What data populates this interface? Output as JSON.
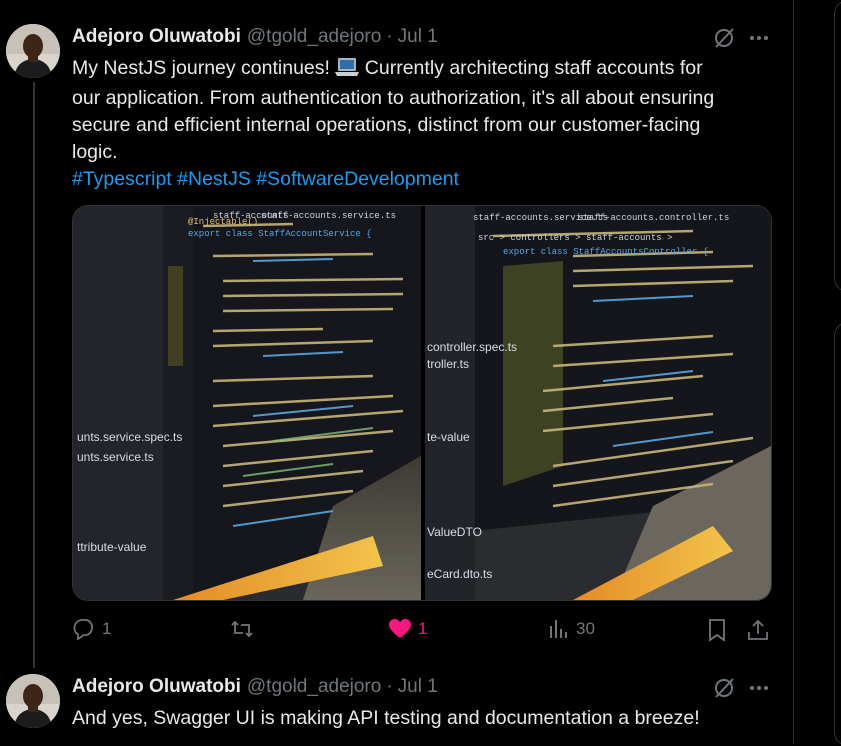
{
  "tweet1": {
    "author_name": "Adejoro Oluwatobi",
    "handle": "@tgold_adejoro",
    "separator": "·",
    "date": "Jul 1",
    "text_line1": "My NestJS journey continues! ",
    "emoji": "laptop-emoji",
    "text_line1b": " Currently architecting staff accounts for",
    "text_line2": "our application. From authentication to authorization, it's all about ensuring",
    "text_line3": "secure and efficient internal operations, distinct from our customer-facing",
    "text_line4": "logic.",
    "hashtags": [
      "#Typescript",
      "#NestJS",
      "#SoftwareDevelopment"
    ],
    "media": {
      "left_photo_icon": "code-editor-photo",
      "right_photo_icon": "code-editor-photo",
      "left_tab": "staff-accounts",
      "left_tab2": "staff-accounts.service.ts",
      "left_code_class": "export class StaffAccountService {",
      "left_decorator": "@Injectable()",
      "right_tab": "staff-accounts.service.ts",
      "right_tab2": "staff-accounts.controller.ts",
      "right_breadcrumb": "src > controllers > staff-accounts >",
      "right_code_class": "export class StaffAccountsController {",
      "sidebar_left_1": "unts.service.spec.ts",
      "sidebar_left_2": "unts.service.ts",
      "sidebar_left_3": "ttribute-value",
      "sidebar_right_1": "controller.spec.ts",
      "sidebar_right_2": "troller.ts",
      "sidebar_right_3": "te-value",
      "sidebar_right_4": "ValueDTO",
      "sidebar_right_5": "eCard.dto.ts"
    },
    "actions": {
      "reply_count": "1",
      "retweet_count": "",
      "like_count": "1",
      "views_count": "30"
    }
  },
  "tweet2": {
    "author_name": "Adejoro Oluwatobi",
    "handle": "@tgold_adejoro",
    "separator": "·",
    "date": "Jul 1",
    "text": "And yes, Swagger UI is making API testing and documentation a breeze!"
  },
  "colors": {
    "background": "#000000",
    "text": "#e7e9ea",
    "muted": "#71767b",
    "link": "#1d9bf0",
    "like": "#f91880",
    "border": "#2f3336"
  }
}
